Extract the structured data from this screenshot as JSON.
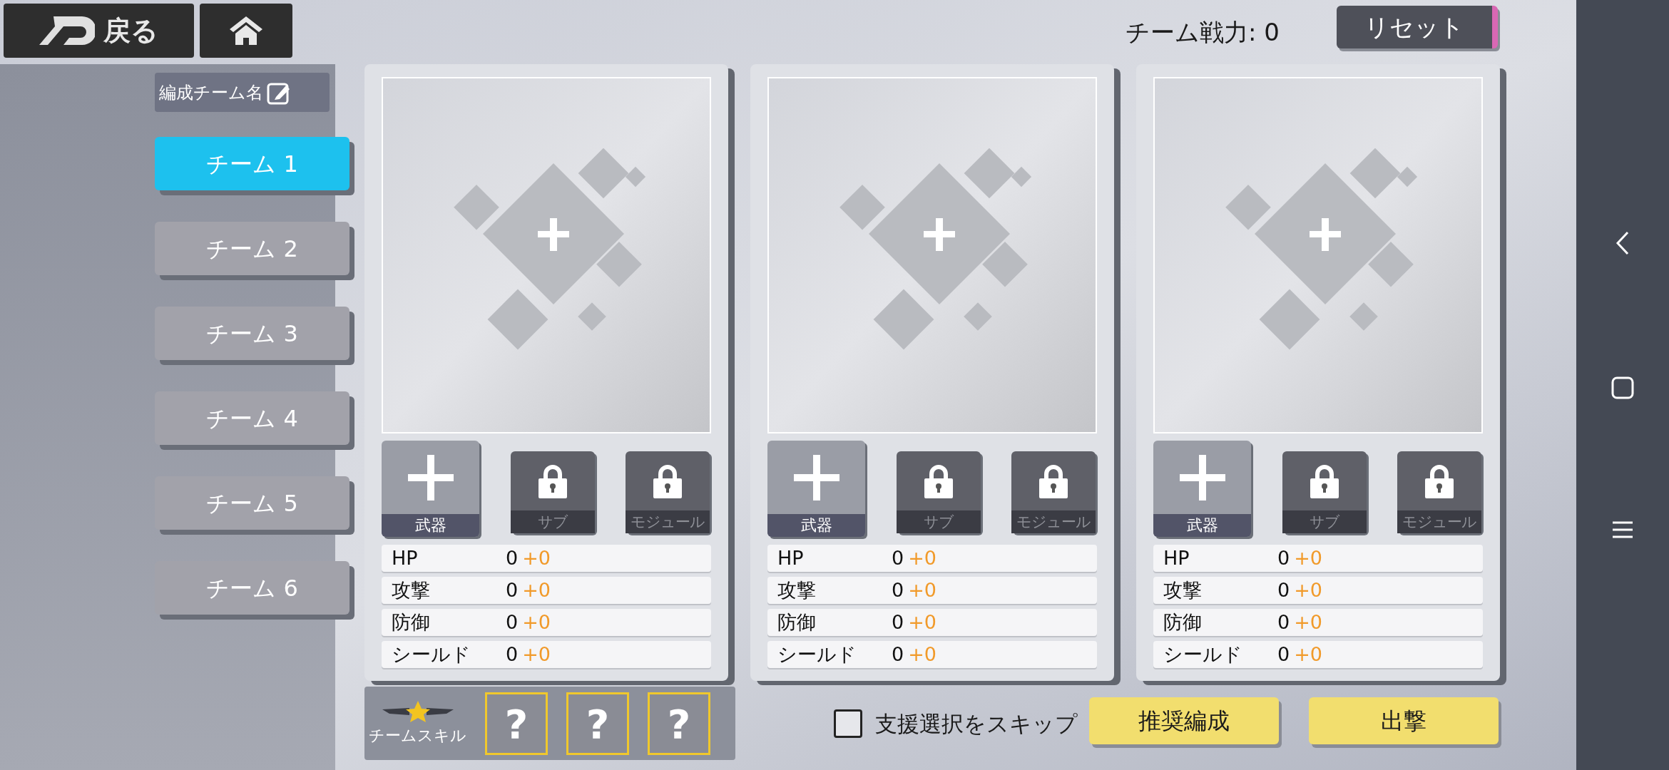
{
  "top_bar": {
    "back_button": "戻る",
    "team_power": {
      "label": "チーム戦力:",
      "value": "0"
    },
    "reset_button": "リセット"
  },
  "sidebar": {
    "team_name_button": "編成チーム名",
    "teams": [
      {
        "label": "チーム 1",
        "selected": true
      },
      {
        "label": "チーム 2",
        "selected": false
      },
      {
        "label": "チーム 3",
        "selected": false
      },
      {
        "label": "チーム 4",
        "selected": false
      },
      {
        "label": "チーム 5",
        "selected": false
      },
      {
        "label": "チーム 6",
        "selected": false
      }
    ]
  },
  "cards": [
    {
      "slots": [
        {
          "kind": "add",
          "label": "武器"
        },
        {
          "kind": "locked",
          "label": "サブ"
        },
        {
          "kind": "locked",
          "label": "モジュール"
        }
      ],
      "stats": [
        {
          "name": "HP",
          "value": "0",
          "bonus": "+0"
        },
        {
          "name": "攻撃",
          "value": "0",
          "bonus": "+0"
        },
        {
          "name": "防御",
          "value": "0",
          "bonus": "+0"
        },
        {
          "name": "シールド",
          "value": "0",
          "bonus": "+0"
        }
      ]
    },
    {
      "slots": [
        {
          "kind": "add",
          "label": "武器"
        },
        {
          "kind": "locked",
          "label": "サブ"
        },
        {
          "kind": "locked",
          "label": "モジュール"
        }
      ],
      "stats": [
        {
          "name": "HP",
          "value": "0",
          "bonus": "+0"
        },
        {
          "name": "攻撃",
          "value": "0",
          "bonus": "+0"
        },
        {
          "name": "防御",
          "value": "0",
          "bonus": "+0"
        },
        {
          "name": "シールド",
          "value": "0",
          "bonus": "+0"
        }
      ]
    },
    {
      "slots": [
        {
          "kind": "add",
          "label": "武器"
        },
        {
          "kind": "locked",
          "label": "サブ"
        },
        {
          "kind": "locked",
          "label": "モジュール"
        }
      ],
      "stats": [
        {
          "name": "HP",
          "value": "0",
          "bonus": "+0"
        },
        {
          "name": "攻撃",
          "value": "0",
          "bonus": "+0"
        },
        {
          "name": "防御",
          "value": "0",
          "bonus": "+0"
        },
        {
          "name": "シールド",
          "value": "0",
          "bonus": "+0"
        }
      ]
    }
  ],
  "team_skill": {
    "label": "チームスキル",
    "slots": [
      "?",
      "?",
      "?"
    ]
  },
  "skip_support": {
    "label": "支援選択をスキップ",
    "checked": false
  },
  "buttons": [
    "推奨編成",
    "出撃"
  ]
}
